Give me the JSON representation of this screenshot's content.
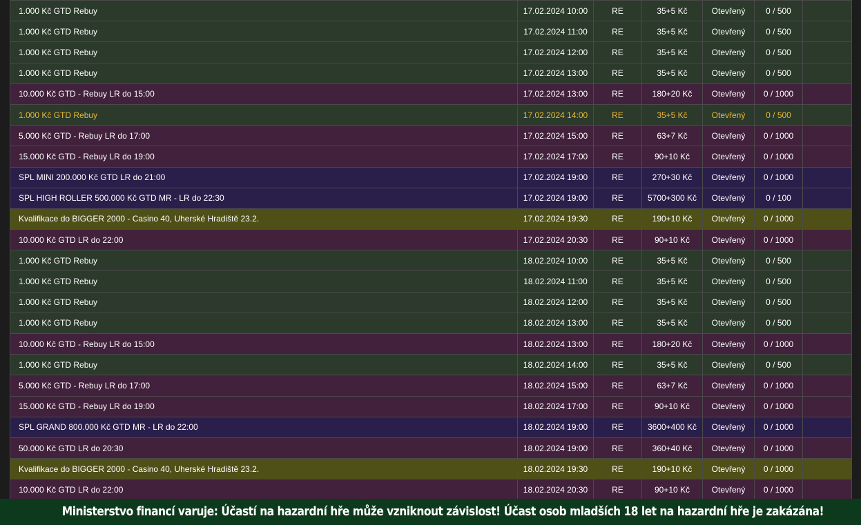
{
  "rows": [
    {
      "name": "1.000 Kč GTD Rebuy",
      "date": "17.02.2024 10:00",
      "type": "RE",
      "buyin": "35+5 Kč",
      "status": "Otevřený",
      "players": "0 / 500",
      "color": "green",
      "hl": false
    },
    {
      "name": "1.000 Kč GTD Rebuy",
      "date": "17.02.2024 11:00",
      "type": "RE",
      "buyin": "35+5 Kč",
      "status": "Otevřený",
      "players": "0 / 500",
      "color": "green",
      "hl": false
    },
    {
      "name": "1.000 Kč GTD Rebuy",
      "date": "17.02.2024 12:00",
      "type": "RE",
      "buyin": "35+5 Kč",
      "status": "Otevřený",
      "players": "0 / 500",
      "color": "green",
      "hl": false
    },
    {
      "name": "1.000 Kč GTD Rebuy",
      "date": "17.02.2024 13:00",
      "type": "RE",
      "buyin": "35+5 Kč",
      "status": "Otevřený",
      "players": "0 / 500",
      "color": "green",
      "hl": false
    },
    {
      "name": "10.000 Kč GTD - Rebuy LR do 15:00",
      "date": "17.02.2024 13:00",
      "type": "RE",
      "buyin": "180+20 Kč",
      "status": "Otevřený",
      "players": "0 / 1000",
      "color": "purple",
      "hl": false
    },
    {
      "name": "1.000 Kč GTD Rebuy",
      "date": "17.02.2024 14:00",
      "type": "RE",
      "buyin": "35+5 Kč",
      "status": "Otevřený",
      "players": "0 / 500",
      "color": "green",
      "hl": true
    },
    {
      "name": "5.000 Kč GTD - Rebuy LR do 17:00",
      "date": "17.02.2024 15:00",
      "type": "RE",
      "buyin": "63+7 Kč",
      "status": "Otevřený",
      "players": "0 / 1000",
      "color": "purple",
      "hl": false
    },
    {
      "name": "15.000 Kč GTD - Rebuy LR do 19:00",
      "date": "17.02.2024 17:00",
      "type": "RE",
      "buyin": "90+10 Kč",
      "status": "Otevřený",
      "players": "0 / 1000",
      "color": "purple",
      "hl": false
    },
    {
      "name": "SPL MINI 200.000 Kč GTD LR do 21:00",
      "date": "17.02.2024 19:00",
      "type": "RE",
      "buyin": "270+30 Kč",
      "status": "Otevřený",
      "players": "0 / 1000",
      "color": "blue",
      "hl": false
    },
    {
      "name": "SPL HIGH ROLLER 500.000 Kč GTD MR - LR do 22:30",
      "date": "17.02.2024 19:00",
      "type": "RE",
      "buyin": "5700+300 Kč",
      "status": "Otevřený",
      "players": "0 / 100",
      "color": "blue",
      "hl": false
    },
    {
      "name": "Kvalifikace do BIGGER 2000 - Casino 40, Uherské Hradiště 23.2.",
      "date": "17.02.2024 19:30",
      "type": "RE",
      "buyin": "190+10 Kč",
      "status": "Otevřený",
      "players": "0 / 1000",
      "color": "olive",
      "hl": false
    },
    {
      "name": "10.000 Kč GTD LR do 22:00",
      "date": "17.02.2024 20:30",
      "type": "RE",
      "buyin": "90+10 Kč",
      "status": "Otevřený",
      "players": "0 / 1000",
      "color": "purple",
      "hl": false
    },
    {
      "name": "1.000 Kč GTD Rebuy",
      "date": "18.02.2024 10:00",
      "type": "RE",
      "buyin": "35+5 Kč",
      "status": "Otevřený",
      "players": "0 / 500",
      "color": "green",
      "hl": false
    },
    {
      "name": "1.000 Kč GTD Rebuy",
      "date": "18.02.2024 11:00",
      "type": "RE",
      "buyin": "35+5 Kč",
      "status": "Otevřený",
      "players": "0 / 500",
      "color": "green",
      "hl": false
    },
    {
      "name": "1.000 Kč GTD Rebuy",
      "date": "18.02.2024 12:00",
      "type": "RE",
      "buyin": "35+5 Kč",
      "status": "Otevřený",
      "players": "0 / 500",
      "color": "green",
      "hl": false
    },
    {
      "name": "1.000 Kč GTD Rebuy",
      "date": "18.02.2024 13:00",
      "type": "RE",
      "buyin": "35+5 Kč",
      "status": "Otevřený",
      "players": "0 / 500",
      "color": "green",
      "hl": false
    },
    {
      "name": "10.000 Kč GTD - Rebuy LR do 15:00",
      "date": "18.02.2024 13:00",
      "type": "RE",
      "buyin": "180+20 Kč",
      "status": "Otevřený",
      "players": "0 / 1000",
      "color": "purple",
      "hl": false
    },
    {
      "name": "1.000 Kč GTD Rebuy",
      "date": "18.02.2024 14:00",
      "type": "RE",
      "buyin": "35+5 Kč",
      "status": "Otevřený",
      "players": "0 / 500",
      "color": "green",
      "hl": false
    },
    {
      "name": "5.000 Kč GTD - Rebuy LR do 17:00",
      "date": "18.02.2024 15:00",
      "type": "RE",
      "buyin": "63+7 Kč",
      "status": "Otevřený",
      "players": "0 / 1000",
      "color": "purple",
      "hl": false
    },
    {
      "name": "15.000 Kč GTD - Rebuy LR do 19:00",
      "date": "18.02.2024 17:00",
      "type": "RE",
      "buyin": "90+10 Kč",
      "status": "Otevřený",
      "players": "0 / 1000",
      "color": "purple",
      "hl": false
    },
    {
      "name": "SPL GRAND 800.000 Kč GTD MR - LR do 22:00",
      "date": "18.02.2024 19:00",
      "type": "RE",
      "buyin": "3600+400 Kč",
      "status": "Otevřený",
      "players": "0 / 1000",
      "color": "blue",
      "hl": false
    },
    {
      "name": "50.000 Kč GTD LR do 20:30",
      "date": "18.02.2024 19:00",
      "type": "RE",
      "buyin": "360+40 Kč",
      "status": "Otevřený",
      "players": "0 / 1000",
      "color": "purple",
      "hl": false
    },
    {
      "name": "Kvalifikace do BIGGER 2000 - Casino 40, Uherské Hradiště 23.2.",
      "date": "18.02.2024 19:30",
      "type": "RE",
      "buyin": "190+10 Kč",
      "status": "Otevřený",
      "players": "0 / 1000",
      "color": "olive",
      "hl": false
    },
    {
      "name": "10.000 Kč GTD LR do 22:00",
      "date": "18.02.2024 20:30",
      "type": "RE",
      "buyin": "90+10 Kč",
      "status": "Otevřený",
      "players": "0 / 1000",
      "color": "purple",
      "hl": false
    }
  ],
  "footer": {
    "warning": "Ministerstvo financí varuje: Účastí na hazardní hře může vzniknout závislost! Účast osob mladších 18 let na hazardní hře je zakázána!"
  },
  "colors": {
    "green": "#2b3a2a",
    "purple": "#42213c",
    "blue": "#2a1f4a",
    "olive": "#4e5018",
    "highlight": "#e8b93a",
    "footer_bg": "#0d3a1c"
  }
}
